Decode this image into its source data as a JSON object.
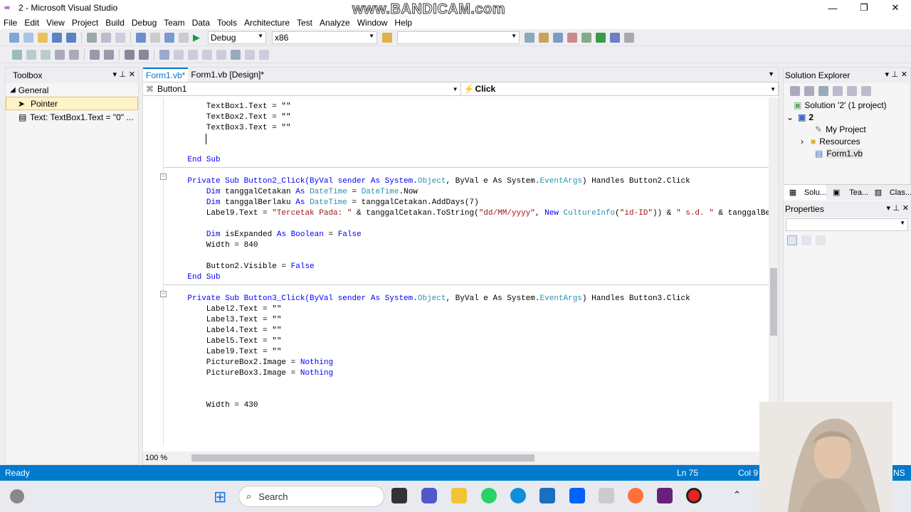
{
  "window": {
    "title": "2 - Microsoft Visual Studio",
    "watermark": "www.BANDICAM.com"
  },
  "menu": [
    "File",
    "Edit",
    "View",
    "Project",
    "Build",
    "Debug",
    "Team",
    "Data",
    "Tools",
    "Architecture",
    "Test",
    "Analyze",
    "Window",
    "Help"
  ],
  "toolbar": {
    "config": "Debug",
    "platform": "x86",
    "find": ""
  },
  "toolbox": {
    "title": "Toolbox",
    "group": "General",
    "items": [
      "Pointer",
      "Text: TextBox1.Text = \"0\" ..."
    ]
  },
  "editor": {
    "tabs": [
      "Form1.vb*",
      "Form1.vb [Design]*"
    ],
    "object_combo": "Button1",
    "event_combo": "Click",
    "zoom": "100 %"
  },
  "code": {
    "l1": "        TextBox1.Text = \"\"",
    "l2": "        TextBox2.Text = \"\"",
    "l3": "        TextBox3.Text = \"\"",
    "l4": "    End Sub",
    "sub2_head": [
      "    Private Sub Button2_Click(ByVal sender As System.",
      "Object",
      ", ByVal e As System.",
      "EventArgs",
      ") Handles Button2.Click"
    ],
    "d1": [
      "        ",
      "Dim",
      " tanggalCetakan ",
      "As",
      " ",
      "DateTime",
      " = ",
      "DateTime",
      ".Now"
    ],
    "d2": [
      "        ",
      "Dim",
      " tanggalBerlaku ",
      "As",
      " ",
      "DateTime",
      " = tanggalCetakan.AddDays(7)"
    ],
    "lab9": [
      "        Label9.Text = ",
      "\"Tercetak Pada: \"",
      " & tanggalCetakan.ToString(",
      "\"dd/MM/yyyy\"",
      ", ",
      "New",
      " ",
      "CultureInfo",
      "(",
      "\"id-ID\"",
      ")) & ",
      "\" s.d. \"",
      " & tanggalBer"
    ],
    "d3": [
      "        ",
      "Dim",
      " isExpanded ",
      "As",
      " ",
      "Boolean",
      " = ",
      "False"
    ],
    "w840": "        Width = 840",
    "b2v": [
      "        Button2.Visible = ",
      "False"
    ],
    "end2": "    End Sub",
    "sub3_head": [
      "    Private Sub Button3_Click(ByVal sender As System.",
      "Object",
      ", ByVal e As System.",
      "EventArgs",
      ") Handles Button3.Click"
    ],
    "lb2": "        Label2.Text = \"\"",
    "lb3": "        Label3.Text = \"\"",
    "lb4": "        Label4.Text = \"\"",
    "lb5": "        Label5.Text = \"\"",
    "lb9": "        Label9.Text = \"\"",
    "pb2": [
      "        PictureBox2.Image = ",
      "Nothing"
    ],
    "pb3": [
      "        PictureBox3.Image = ",
      "Nothing"
    ],
    "w430": "        Width = 430"
  },
  "solution_explorer": {
    "title": "Solution Explorer",
    "solution": "Solution '2' (1 project)",
    "project": "2",
    "items": [
      "My Project",
      "Resources",
      "Form1.vb"
    ],
    "tabs": [
      "Solu...",
      "Tea...",
      "Clas..."
    ]
  },
  "properties": {
    "title": "Properties"
  },
  "status": {
    "state": "Ready",
    "ln": "Ln 75",
    "col": "Col 9",
    "ins": "NS"
  },
  "taskbar": {
    "search": "Search"
  }
}
